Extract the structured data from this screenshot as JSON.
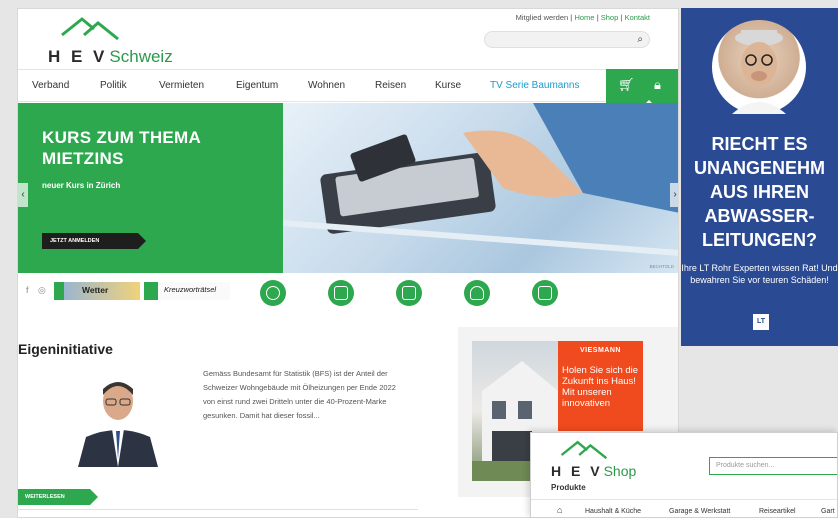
{
  "header": {
    "logo": {
      "letters": "H E V",
      "word": "Schweiz"
    },
    "top_links": [
      "Mitglied werden",
      "Home",
      "Shop",
      "Kontakt"
    ],
    "search_icon": "search-icon"
  },
  "nav": {
    "items": [
      "Verband",
      "Politik",
      "Vermieten",
      "Eigentum",
      "Wohnen",
      "Reisen",
      "Kurse",
      "TV Serie Baumanns"
    ],
    "icons": [
      "cart-icon",
      "lock-icon"
    ]
  },
  "hero": {
    "title_line1": "KURS ZUM THEMA",
    "title_line2": "MIETZINS",
    "subtitle": "neuer Kurs in Zürich",
    "button": "JETZT ANMELDEN",
    "prev": "‹",
    "next": "›",
    "credit": "BECHTOLD"
  },
  "iconrow": {
    "wetter": "Wetter",
    "kreuzwort": "Kreuzworträtsel",
    "circle_icons": [
      "community-icon",
      "chart-icon",
      "calculator-icon",
      "person-icon",
      "document-icon"
    ]
  },
  "main": {
    "section_title": "Eigeninitiative",
    "article_text": "Gemäss Bundesamt für Statistik (BFS) ist der Anteil der Schweizer Wohngebäude mit Ölheizungen per Ende 2022 von einst rund zwei Dritteln unter die 40-Prozent-Marke gesunken. Damit hat dieser fossil...",
    "read_more": "WEITERLESEN"
  },
  "viessmann": {
    "logo": "VIESMANN",
    "text": "Holen Sie sich die Zukunft ins Haus! Mit unseren innovativen"
  },
  "ad": {
    "headline": "RIECHT ES UNANGENEHM AUS IHREN ABWASSER-LEITUNGEN?",
    "body": "Ihre LT Rohr Experten wissen Rat! Und bewahren Sie vor teuren Schäden!",
    "badge": "LT"
  },
  "shop": {
    "logo_letters": "H E V",
    "logo_word": "Shop",
    "logo_sub": "Produkte",
    "search_placeholder": "Produkte suchen...",
    "nav": [
      "Haushalt & Küche",
      "Garage & Werkstatt",
      "Reiseartikel",
      "Gart"
    ]
  },
  "colors": {
    "brand_green": "#2ea84f",
    "accent_blue": "#1a9bcf",
    "ad_blue": "#2a4a93",
    "viessmann_red": "#f04b1e"
  }
}
